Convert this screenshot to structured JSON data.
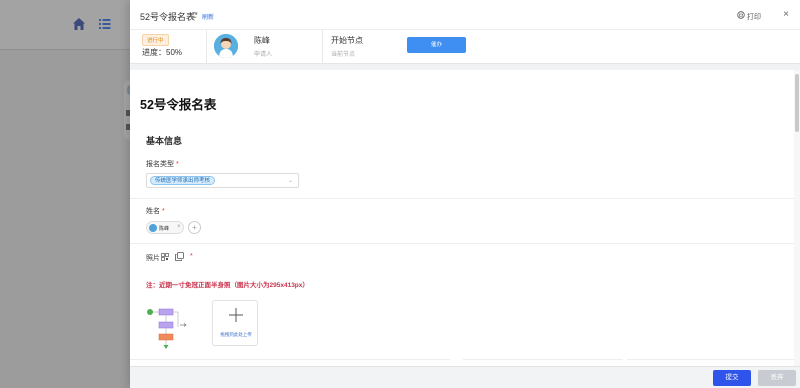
{
  "header": {
    "title": "52号令报名表",
    "refresh_label": "刷新",
    "print_label": "打印",
    "close_symbol": "×"
  },
  "info_bar": {
    "status": "进行中",
    "progress": "进度：50%",
    "progress_percent": 50,
    "owner_name": "陈峰",
    "owner_role": "申请人",
    "node_name": "开始节点",
    "node_label": "当前节点",
    "urge_label": "催办"
  },
  "form": {
    "title": "52号令报名表",
    "section_title": "基本信息",
    "type_label": "报名类型",
    "type_value": "传统医学师承出师考核",
    "name_label": "姓名",
    "name_value": "陈峰",
    "photo_label": "照片",
    "required_mark": "*",
    "note": "注：近期一寸免冠正面半身照（图片大小为295x413px）",
    "upload_text": "拖拽到此处上传"
  },
  "footer": {
    "submit_label": "提交",
    "discard_label": "丢弃"
  },
  "colors": {
    "primary": "#2f54eb",
    "urge": "#3f8ef2",
    "status_orange": "#e08a1c",
    "note_red": "#c8324b"
  },
  "icons": [
    "home-icon",
    "list-icon",
    "refresh-icon",
    "print-icon",
    "close-icon",
    "qr-code-icon",
    "copy-icon",
    "plus-icon",
    "chevron-down-icon"
  ]
}
